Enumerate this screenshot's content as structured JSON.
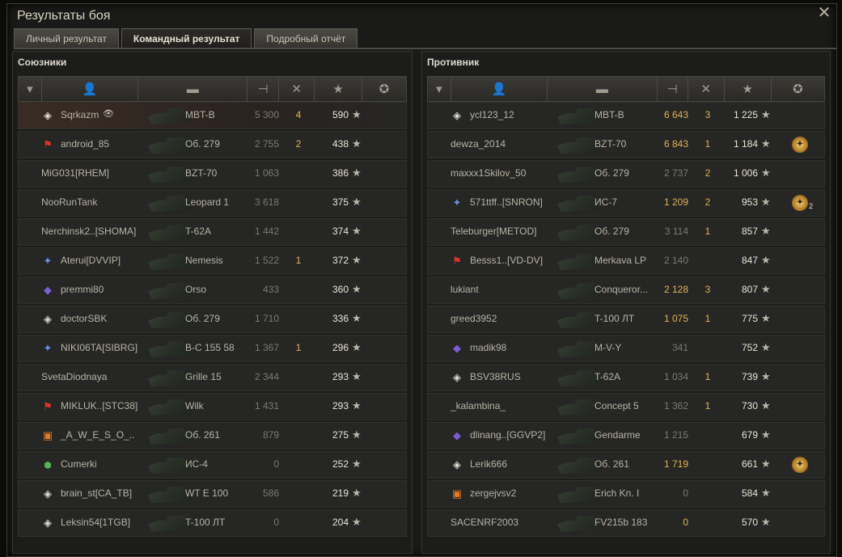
{
  "window": {
    "title": "Результаты боя"
  },
  "tabs": [
    {
      "label": "Личный результат",
      "active": false
    },
    {
      "label": "Командный результат",
      "active": true
    },
    {
      "label": "Подробный отчёт",
      "active": false
    }
  ],
  "allies": {
    "title": "Союзники",
    "players": [
      {
        "name": "Sqrkazm",
        "tank": "MBT-B",
        "damage": "5 300",
        "kills": "4",
        "xp": "590",
        "badge": "diamond",
        "highlight": true,
        "dmg_hi": false,
        "eye": true
      },
      {
        "name": "android_85",
        "tank": "Об. 279",
        "damage": "2 755",
        "kills": "2",
        "xp": "438",
        "badge": "red",
        "highlight": false,
        "dmg_hi": false
      },
      {
        "name": "MiG031[RHEM]",
        "tank": "BZT-70",
        "damage": "1 063",
        "kills": "",
        "xp": "386",
        "badge": "",
        "highlight": false,
        "dmg_hi": false
      },
      {
        "name": "NooRunTank",
        "tank": "Leopard 1",
        "damage": "3 618",
        "kills": "",
        "xp": "375",
        "badge": "",
        "highlight": false,
        "dmg_hi": false
      },
      {
        "name": "Nerchinsk2..[SHOMA]",
        "tank": "T-62A",
        "damage": "1 442",
        "kills": "",
        "xp": "374",
        "badge": "",
        "highlight": false,
        "dmg_hi": false
      },
      {
        "name": "Aterui[DVVIP]",
        "tank": "Nemesis",
        "damage": "1 522",
        "kills": "1",
        "xp": "372",
        "badge": "blue",
        "highlight": false,
        "dmg_hi": false
      },
      {
        "name": "premmi80",
        "tank": "Orso",
        "damage": "433",
        "kills": "",
        "xp": "360",
        "badge": "purple",
        "highlight": false,
        "dmg_hi": false
      },
      {
        "name": "doctorSBK",
        "tank": "Об. 279",
        "damage": "1 710",
        "kills": "",
        "xp": "336",
        "badge": "diamond",
        "highlight": false,
        "dmg_hi": false
      },
      {
        "name": "NIKI06TA[SIBRG]",
        "tank": "B-C 155 58",
        "damage": "1 367",
        "kills": "1",
        "xp": "296",
        "badge": "blue",
        "highlight": false,
        "dmg_hi": false
      },
      {
        "name": "SvetaDiodnaya",
        "tank": "Grille 15",
        "damage": "2 344",
        "kills": "",
        "xp": "293",
        "badge": "",
        "highlight": false,
        "dmg_hi": false
      },
      {
        "name": "MIKLUK..[STC38]",
        "tank": "Wilk",
        "damage": "1 431",
        "kills": "",
        "xp": "293",
        "badge": "red",
        "highlight": false,
        "dmg_hi": false
      },
      {
        "name": "_A_W_E_S_O_..",
        "tank": "Об. 261",
        "damage": "879",
        "kills": "",
        "xp": "275",
        "badge": "colorful",
        "highlight": false,
        "dmg_hi": false
      },
      {
        "name": "Cumerki",
        "tank": "ИС-4",
        "damage": "0",
        "kills": "",
        "xp": "252",
        "badge": "green",
        "highlight": false,
        "dmg_hi": false
      },
      {
        "name": "brain_st[CA_TB]",
        "tank": "WT E 100",
        "damage": "586",
        "kills": "",
        "xp": "219",
        "badge": "diamond",
        "highlight": false,
        "dmg_hi": false
      },
      {
        "name": "Leksin54[1TGB]",
        "tank": "T-100 ЛТ",
        "damage": "0",
        "kills": "",
        "xp": "204",
        "badge": "diamond",
        "highlight": false,
        "dmg_hi": false
      }
    ]
  },
  "enemies": {
    "title": "Противник",
    "players": [
      {
        "name": "ycl123_12",
        "tank": "MBT-B",
        "damage": "6 643",
        "kills": "3",
        "xp": "1 225",
        "badge": "diamond",
        "dmg_hi": true,
        "medal": false,
        "medal_count": ""
      },
      {
        "name": "dewza_2014",
        "tank": "BZT-70",
        "damage": "6 843",
        "kills": "1",
        "xp": "1 184",
        "badge": "",
        "dmg_hi": true,
        "medal": true,
        "medal_count": ""
      },
      {
        "name": "maxxx1Skilov_50",
        "tank": "Об. 279",
        "damage": "2 737",
        "kills": "2",
        "xp": "1 006",
        "badge": "",
        "dmg_hi": false,
        "medal": false,
        "medal_count": ""
      },
      {
        "name": "571ttff..[SNRON]",
        "tank": "ИС-7",
        "damage": "1 209",
        "kills": "2",
        "xp": "953",
        "badge": "blue",
        "dmg_hi": true,
        "medal": true,
        "medal_count": "2"
      },
      {
        "name": "Teleburger[METOD]",
        "tank": "Об. 279",
        "damage": "3 114",
        "kills": "1",
        "xp": "857",
        "badge": "",
        "dmg_hi": false,
        "medal": false,
        "medal_count": ""
      },
      {
        "name": "Besss1..[VD-DV]",
        "tank": "Merkava LP",
        "damage": "2 140",
        "kills": "",
        "xp": "847",
        "badge": "red",
        "dmg_hi": false,
        "medal": false,
        "medal_count": ""
      },
      {
        "name": "lukiant",
        "tank": "Conqueror...",
        "damage": "2 128",
        "kills": "3",
        "xp": "807",
        "badge": "",
        "dmg_hi": true,
        "medal": false,
        "medal_count": ""
      },
      {
        "name": "greed3952",
        "tank": "T-100 ЛТ",
        "damage": "1 075",
        "kills": "1",
        "xp": "775",
        "badge": "",
        "dmg_hi": true,
        "medal": false,
        "medal_count": ""
      },
      {
        "name": "madik98",
        "tank": "M-V-Y",
        "damage": "341",
        "kills": "",
        "xp": "752",
        "badge": "purple",
        "dmg_hi": false,
        "medal": false,
        "medal_count": ""
      },
      {
        "name": "BSV38RUS",
        "tank": "T-62A",
        "damage": "1 034",
        "kills": "1",
        "xp": "739",
        "badge": "diamond",
        "dmg_hi": false,
        "medal": false,
        "medal_count": ""
      },
      {
        "name": "_kalambina_",
        "tank": "Concept 5",
        "damage": "1 362",
        "kills": "1",
        "xp": "730",
        "badge": "",
        "dmg_hi": false,
        "medal": false,
        "medal_count": ""
      },
      {
        "name": "dlinang..[GGVP2]",
        "tank": "Gendarme",
        "damage": "1 215",
        "kills": "",
        "xp": "679",
        "badge": "purple",
        "dmg_hi": false,
        "medal": false,
        "medal_count": ""
      },
      {
        "name": "Lerik666",
        "tank": "Об. 261",
        "damage": "1 719",
        "kills": "",
        "xp": "661",
        "badge": "diamond",
        "dmg_hi": true,
        "medal": true,
        "medal_count": ""
      },
      {
        "name": "zergejvsv2",
        "tank": "Erich Kn. I",
        "damage": "0",
        "kills": "",
        "xp": "584",
        "badge": "colorful",
        "dmg_hi": false,
        "medal": false,
        "medal_count": ""
      },
      {
        "name": "SACENRF2003",
        "tank": "FV215b 183",
        "damage": "0",
        "kills": "",
        "xp": "570",
        "badge": "",
        "dmg_hi": true,
        "medal": false,
        "medal_count": ""
      }
    ]
  },
  "icons": {
    "close": "close-icon",
    "header": [
      "rank-icon",
      "player-icon",
      "tank-icon",
      "damage-icon",
      "kills-icon",
      "xp-icon",
      "medal-icon"
    ]
  },
  "colors": {
    "accent_damage": "#e0b25a",
    "highlight_row": "#3a2c24"
  }
}
